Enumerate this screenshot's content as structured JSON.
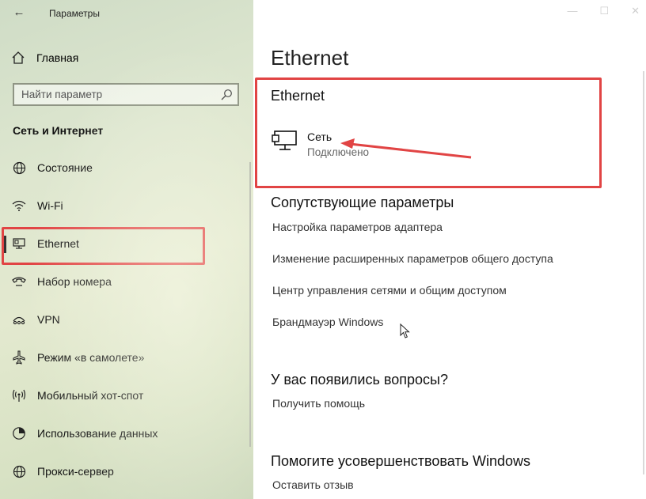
{
  "window": {
    "title": "Параметры"
  },
  "sidebar": {
    "home_label": "Главная",
    "search_placeholder": "Найти параметр",
    "section_title": "Сеть и Интернет",
    "items": [
      {
        "label": "Состояние",
        "icon": "globe-icon"
      },
      {
        "label": "Wi-Fi",
        "icon": "wifi-icon"
      },
      {
        "label": "Ethernet",
        "icon": "ethernet-icon",
        "active": true
      },
      {
        "label": "Набор номера",
        "icon": "dialup-icon"
      },
      {
        "label": "VPN",
        "icon": "vpn-icon"
      },
      {
        "label": "Режим «в самолете»",
        "icon": "airplane-icon"
      },
      {
        "label": "Мобильный хот-спот",
        "icon": "hotspot-icon"
      },
      {
        "label": "Использование данных",
        "icon": "data-usage-icon"
      },
      {
        "label": "Прокси-сервер",
        "icon": "globe-icon"
      }
    ]
  },
  "main": {
    "page_title": "Ethernet",
    "section_title": "Ethernet",
    "network": {
      "name": "Сеть",
      "status": "Подключено"
    },
    "related": {
      "heading": "Сопутствующие параметры",
      "links": [
        "Настройка параметров адаптера",
        "Изменение расширенных параметров общего доступа",
        "Центр управления сетями и общим доступом",
        "Брандмауэр Windows"
      ]
    },
    "questions": {
      "heading": "У вас появились вопросы?",
      "link": "Получить помощь"
    },
    "improve": {
      "heading": "Помогите усовершенствовать Windows",
      "link": "Оставить отзыв"
    }
  },
  "colors": {
    "annotation": "#e14444"
  }
}
